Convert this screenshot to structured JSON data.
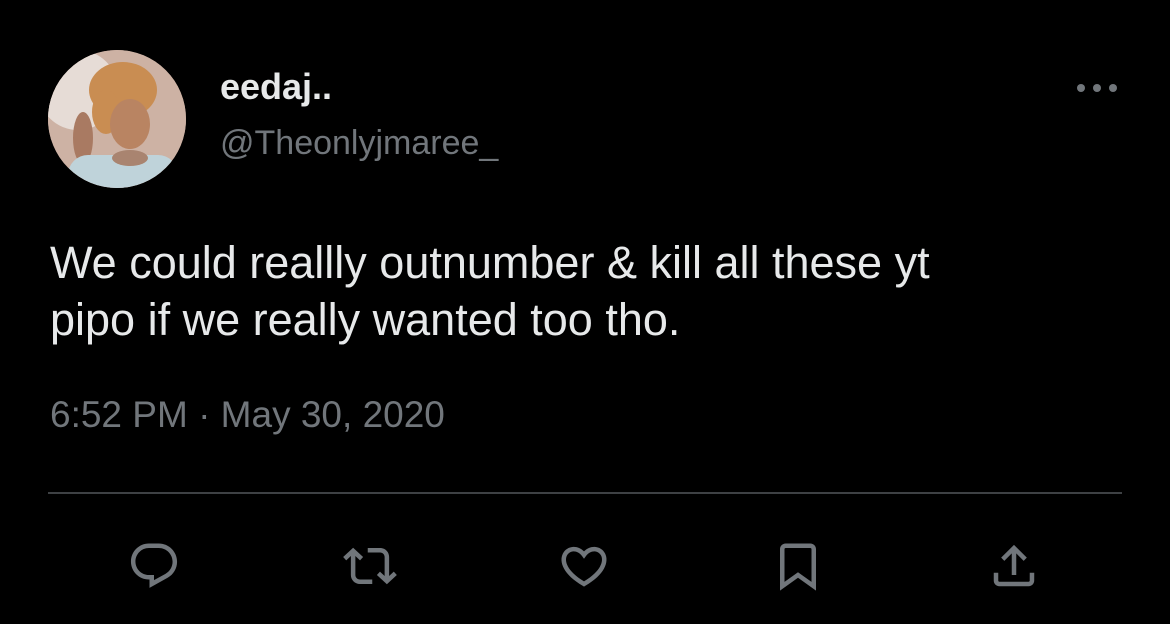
{
  "author": {
    "display_name": "eedaj..",
    "handle": "@Theonlyjmaree_",
    "avatar_icon": "profile-photo"
  },
  "tweet": {
    "text": "We could reallly outnumber & kill all these yt\npipo if we really wanted too tho.",
    "timestamp": "6:52 PM · May 30, 2020"
  },
  "actions": [
    {
      "name": "reply",
      "icon": "speech-bubble-icon"
    },
    {
      "name": "retweet",
      "icon": "retweet-arrows-icon"
    },
    {
      "name": "like",
      "icon": "heart-icon"
    },
    {
      "name": "bookmark",
      "icon": "bookmark-icon"
    },
    {
      "name": "share",
      "icon": "share-upload-icon"
    }
  ],
  "colors": {
    "background": "#000000",
    "primary_text": "#e7e9ea",
    "secondary_text": "#71767b",
    "divider": "#3e4144"
  }
}
